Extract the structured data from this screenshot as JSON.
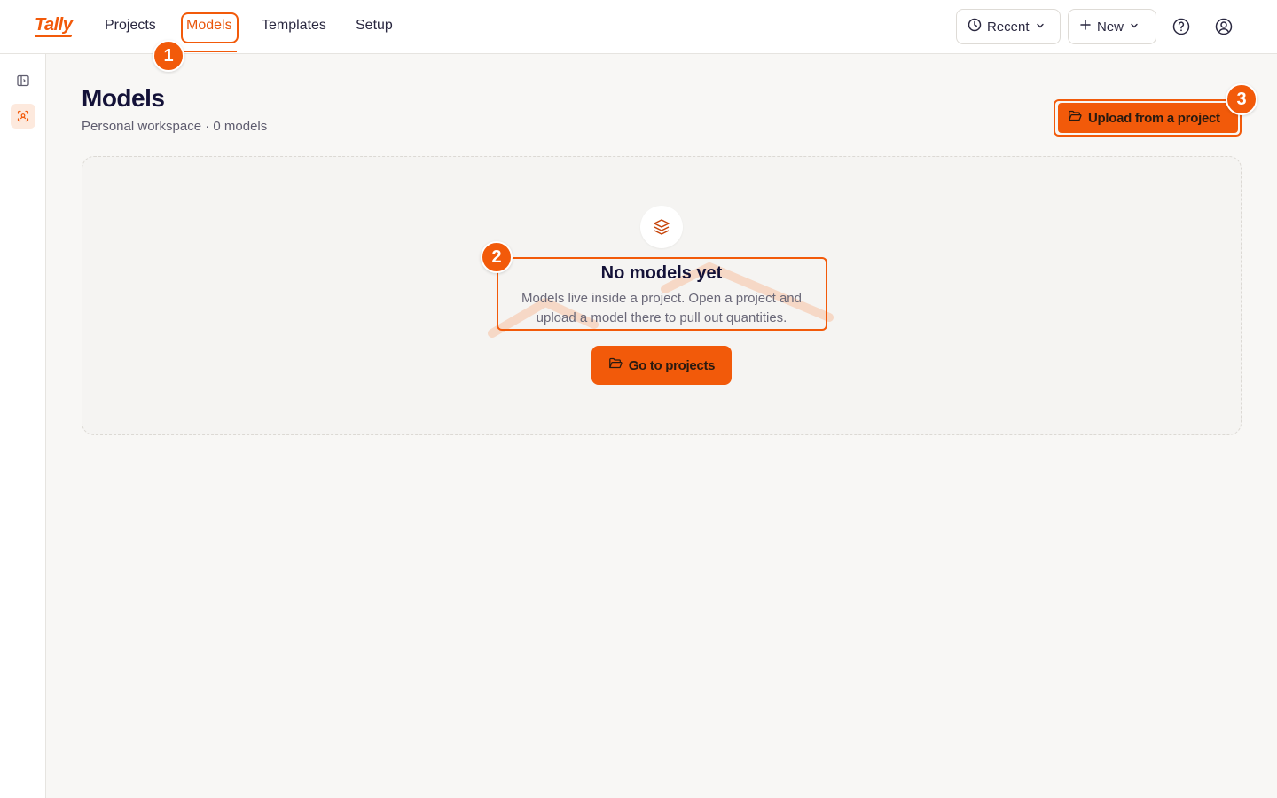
{
  "brand": {
    "name": "Tally",
    "accent": "#f25a0a"
  },
  "nav": {
    "items": [
      {
        "label": "Projects"
      },
      {
        "label": "Models",
        "active": true
      },
      {
        "label": "Templates"
      },
      {
        "label": "Setup"
      }
    ]
  },
  "header_actions": {
    "recent_label": "Recent",
    "new_label": "New"
  },
  "page": {
    "title": "Models",
    "subtitle": "Personal workspace · 0 models",
    "upload_label": "Upload from a project"
  },
  "empty_state": {
    "title": "No models yet",
    "description": "Models live inside a project. Open a project and upload a model there to pull out quantities.",
    "cta_label": "Go to projects"
  },
  "annotations": {
    "badge_1": "1",
    "badge_2": "2",
    "badge_3": "3"
  }
}
